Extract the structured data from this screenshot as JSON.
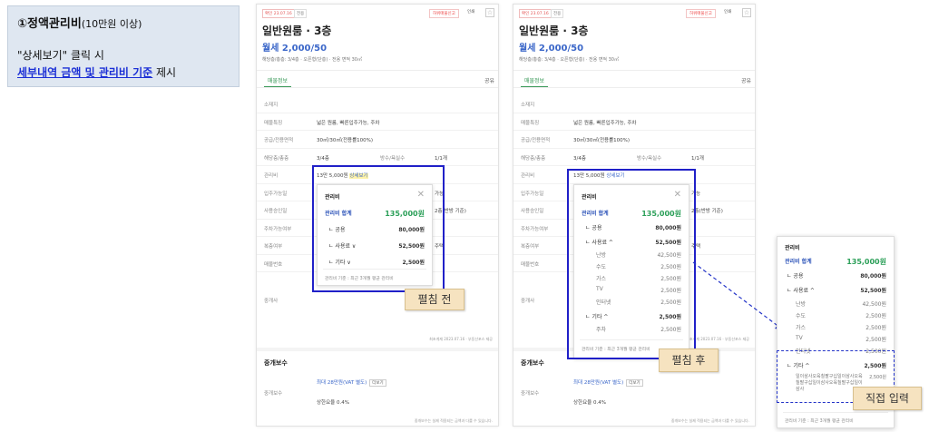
{
  "note": {
    "title": "①정액관리비",
    "title_sub": "(10만원 이상)",
    "line2": "\"상세보기\" 클릭 시",
    "line3_highlight": "세부내역 금액 및 관리비 기준",
    "line3_tail": " 제시"
  },
  "panel": {
    "badge": "확인 23.07.16",
    "badge2": "전용",
    "report": "허위매물신고",
    "print": "인쇄",
    "title": "일반원룸 · 3층",
    "price": "월세 2,000/50",
    "meta": "해당층/총층: 3/4층 · 오픈형(단층) · 전용 면적 30㎡",
    "tab": "매물정보",
    "share": "공유",
    "rows": {
      "location": "소재지",
      "feature_k": "매물특징",
      "feature_v": "넓은 원룸, 빠른입주가능, 주차",
      "area_k": "공급/전용면적",
      "area_v": "30㎡/30㎡(전용률100%)",
      "floor_k": "해당층/총층",
      "floor_v": "3/4층",
      "rooms_k": "방수/욕실수",
      "rooms_v": "1/1개",
      "fee_k": "관리비",
      "fee_v": "13만 5,000원",
      "fee_link": "상세보기",
      "movein_k": "입주가능일",
      "approval_k": "사용승인일",
      "parking_k": "주차가능여부",
      "duplex_k": "복층여부",
      "listing_k": "매물번호",
      "side1": "가능",
      "side2": "2층(반방 기준)",
      "side3": "주택",
      "agent_k": "중개사"
    },
    "footnote": "최초게재 2023.07.16 · 부동산포스 제공",
    "commission_title": "중개보수",
    "commission_k": "중개보수",
    "commission_v": "최대 28만원(VAT 별도)",
    "commission_btn": "더보기",
    "rate_k": "상한요율",
    "rate_v": "상한요율  0.4%",
    "bottom_note": "중개보수는 실제 적용되는 금액과 다를 수 있습니다."
  },
  "popup": {
    "header": "관리비",
    "total_label": "관리비 합계",
    "total": "135,000원",
    "common_label": "ㄴ 공용",
    "common": "80,000원",
    "usage_label_a": "ㄴ 사용료 ∨",
    "usage_label_b": "ㄴ 사용료 ^",
    "usage": "52,500원",
    "heating_label": "난방",
    "heating": "42,500원",
    "water_label": "수도",
    "water": "2,500원",
    "gas_label": "가스",
    "gas": "2,500원",
    "tv_label": "TV",
    "tv": "2,500원",
    "internet_label": "인터넷",
    "internet": "2,500원",
    "etc_label_a": "ㄴ 기타 ∨",
    "etc_label_b": "ㄴ 기타 ^",
    "etc": "2,500원",
    "cleaning_label": "주차",
    "cleaning": "2,500원",
    "cleaning_long": "일이삼사오육칠팔구십일이삼사오육칠팔구십일이삼사오육칠팔구십일이삼사",
    "footer": "관리비 기준 : 최근 3개월 평균 관리비"
  },
  "labels": {
    "before": "펼침 전",
    "after": "펼침 후",
    "direct": "직접 입력"
  },
  "colors": {
    "annotation_blue": "#2020c8",
    "label_bg": "#f6e3c0",
    "note_bg": "#dfe7f1",
    "price_blue": "#3b67c9",
    "total_green": "#2b9f58"
  }
}
